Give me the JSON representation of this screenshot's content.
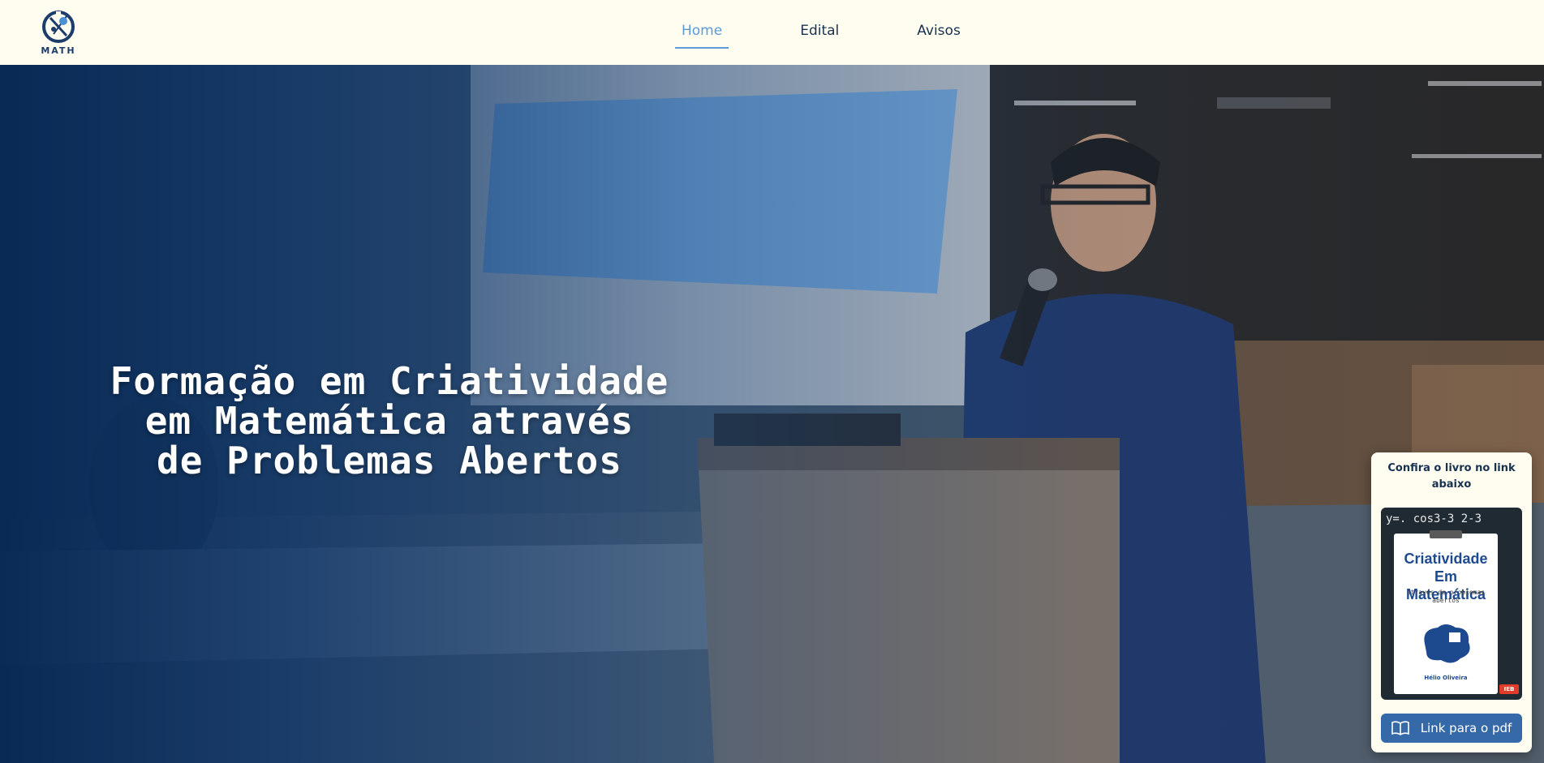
{
  "logo": {
    "text": "MATH",
    "icon": "creative-math-logo-icon"
  },
  "nav": {
    "items": [
      {
        "label": "Home",
        "active": true
      },
      {
        "label": "Edital",
        "active": false
      },
      {
        "label": "Avisos",
        "active": false
      }
    ]
  },
  "hero": {
    "title": "Formação em Criatividade\nem Matemática através\nde Problemas Abertos",
    "background": "photo of a presenter speaking at a podium with a projection screen behind"
  },
  "book_card": {
    "heading": "Confira o livro no link abaixo",
    "cover": {
      "chalkboard_text": "y=. cos3-3 2-3",
      "title": "Criatividade Em\nMatemática",
      "subtitle": "através de problemas abertos",
      "author": "Hélio Oliveira",
      "publisher_badge": "IEB"
    },
    "button_label": "Link para o pdf",
    "button_icon": "open-book-icon"
  },
  "colors": {
    "header_bg": "#fffdf0",
    "nav_active": "#5c9bd8",
    "nav_text": "#17324f",
    "hero_overlay": "#0b3a6e",
    "button_bg": "#3569a8"
  }
}
